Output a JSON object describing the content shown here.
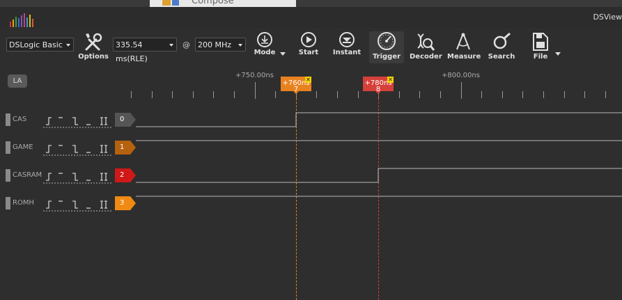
{
  "background_window": {
    "title": "Compose"
  },
  "app": {
    "title": "DSView"
  },
  "device_select": {
    "value": "DSLogic Basic"
  },
  "duration_select": {
    "value": "335.54 ms(RLE)"
  },
  "at_symbol": "@",
  "rate_select": {
    "value": "200 MHz"
  },
  "toolbar": {
    "options": "Options",
    "mode": "Mode",
    "start": "Start",
    "instant": "Instant",
    "trigger": "Trigger",
    "decoder": "Decoder",
    "measure": "Measure",
    "search": "Search",
    "file": "File"
  },
  "ruler": {
    "la_button": "LA",
    "labels": [
      "+750.00ns",
      "+800.00ns"
    ]
  },
  "cursors": [
    {
      "time": "+760ns",
      "index": "7",
      "color": "#e8821f"
    },
    {
      "time": "+780ns",
      "index": "8",
      "color": "#d6403a"
    }
  ],
  "channels": [
    {
      "name": "CAS",
      "index": "0",
      "color": "#555555",
      "levels": [
        0,
        1
      ]
    },
    {
      "name": "GAME",
      "index": "1",
      "color": "#b5620e",
      "levels": [
        1,
        1
      ]
    },
    {
      "name": "CASRAM",
      "index": "2",
      "color": "#d01818",
      "levels": [
        0,
        1
      ]
    },
    {
      "name": "ROMH",
      "index": "3",
      "color": "#f08a12",
      "levels": [
        1,
        1
      ]
    }
  ],
  "colors": {
    "accent": "#e8821f",
    "background": "#2e2e2e",
    "trace": "#b8b8b8"
  }
}
